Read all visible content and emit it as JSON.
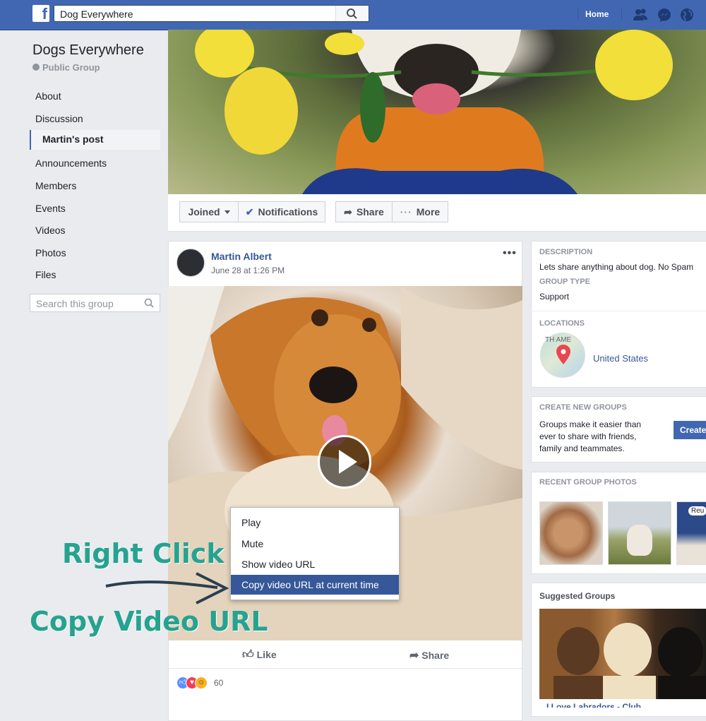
{
  "topbar": {
    "logo": "f",
    "search_value": "Dog Everywhere",
    "home_label": "Home",
    "icons": [
      "friends-icon",
      "messenger-icon",
      "globe-icon"
    ]
  },
  "sidebar": {
    "group_name": "Dogs Everywhere",
    "group_privacy": "Public Group",
    "items": [
      {
        "label": "About"
      },
      {
        "label": "Discussion"
      },
      {
        "label": "Martin's post"
      },
      {
        "label": "Announcements"
      },
      {
        "label": "Members"
      },
      {
        "label": "Events"
      },
      {
        "label": "Videos"
      },
      {
        "label": "Photos"
      },
      {
        "label": "Files"
      }
    ],
    "search_placeholder": "Search this group"
  },
  "actions": {
    "joined": "Joined",
    "notifications": "Notifications",
    "share": "Share",
    "more": "More"
  },
  "post": {
    "author": "Martin Albert",
    "time": "June 28 at 1:26 PM",
    "dots": "•••",
    "like": "Like",
    "share": "Share",
    "reaction_count": "60"
  },
  "context_menu": {
    "items": [
      "Play",
      "Mute",
      "Show video URL",
      "Copy video URL at current time"
    ],
    "highlighted_index": 3
  },
  "overlay": {
    "right_click": "Right Click",
    "copy_url": "Copy Video URL"
  },
  "right": {
    "description_head": "DESCRIPTION",
    "description_text": "Lets share anything about dog. No Spam",
    "type_head": "GROUP TYPE",
    "type_text": "Support",
    "locations_head": "LOCATIONS",
    "map_text": "TH AME",
    "location": "United States",
    "create_head": "CREATE NEW GROUPS",
    "create_text_1": "Groups make it easier than",
    "create_text_2": "ever to share with friends,",
    "create_text_3": "family and teammates.",
    "create_button": "Create",
    "photos_head": "RECENT GROUP PHOTOS",
    "photo_badge": "Reu",
    "suggested_head": "Suggested Groups",
    "suggested_title": "I Love Labradors - Club"
  },
  "colors": {
    "brand": "#4267b2",
    "link": "#365899",
    "overlay_text": "#26a390"
  }
}
